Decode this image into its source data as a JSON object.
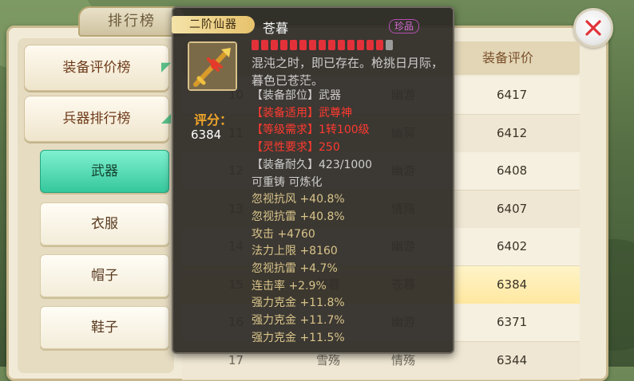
{
  "window": {
    "title": "排行榜"
  },
  "sidebar": {
    "categories": [
      {
        "label": "装备评价榜"
      },
      {
        "label": "兵器排行榜"
      }
    ],
    "sub_items": [
      {
        "label": "武器",
        "active": true
      },
      {
        "label": "衣服"
      },
      {
        "label": "帽子"
      },
      {
        "label": "鞋子"
      }
    ]
  },
  "table": {
    "headers": {
      "score": "装备评价"
    },
    "rows": [
      {
        "rank": "10",
        "server": "幽游",
        "score": "6417"
      },
      {
        "rank": "11",
        "server": "幽冥",
        "score": "6412"
      },
      {
        "rank": "12",
        "server": "幽游",
        "score": "6408"
      },
      {
        "rank": "13",
        "server": "情殇",
        "score": "6407"
      },
      {
        "rank": "14",
        "server": "幽游",
        "score": "6402"
      },
      {
        "rank": "15",
        "player": "苍暮",
        "server": "苍暮",
        "score": "6384",
        "highlight": true
      },
      {
        "rank": "16",
        "server": "幽游",
        "score": "6371"
      },
      {
        "rank": "17",
        "player": "雪殇",
        "server": "情殇",
        "score": "6344"
      }
    ]
  },
  "tooltip": {
    "tier": "二阶仙器",
    "name": "苍暮",
    "rarity": "珍品",
    "gems_filled": 14,
    "gems_total": 15,
    "score_label": "评分：",
    "score_value": "6384",
    "description": "混沌之时，即已存在。枪挑日月际，暮色已苍茫。",
    "lines": [
      {
        "text": "【装备部位】武器",
        "color": "grey"
      },
      {
        "text": "【装备适用】武尊神",
        "color": "red"
      },
      {
        "text": "【等级需求】1转100级",
        "color": "red"
      },
      {
        "text": "【灵性要求】250",
        "color": "red"
      },
      {
        "text": "【装备耐久】423/1000",
        "color": "grey"
      },
      {
        "text": "可重铸 可炼化",
        "color": "grey"
      },
      {
        "text": "忽视抗风 +40.8%",
        "color": "gold"
      },
      {
        "text": "忽视抗雷 +40.8%",
        "color": "gold"
      },
      {
        "text": "攻击 +4760",
        "color": "gold"
      },
      {
        "text": "法力上限 +8160",
        "color": "gold"
      },
      {
        "text": "忽视抗雷 +4.7%",
        "color": "gold"
      },
      {
        "text": "连击率 +2.9%",
        "color": "gold"
      },
      {
        "text": "强力克金 +11.8%",
        "color": "gold"
      },
      {
        "text": "强力克金 +11.7%",
        "color": "gold"
      },
      {
        "text": "强力克金 +11.5%",
        "color": "gold"
      }
    ]
  },
  "icons": {
    "close": "close-icon",
    "weapon": "spear-icon"
  }
}
